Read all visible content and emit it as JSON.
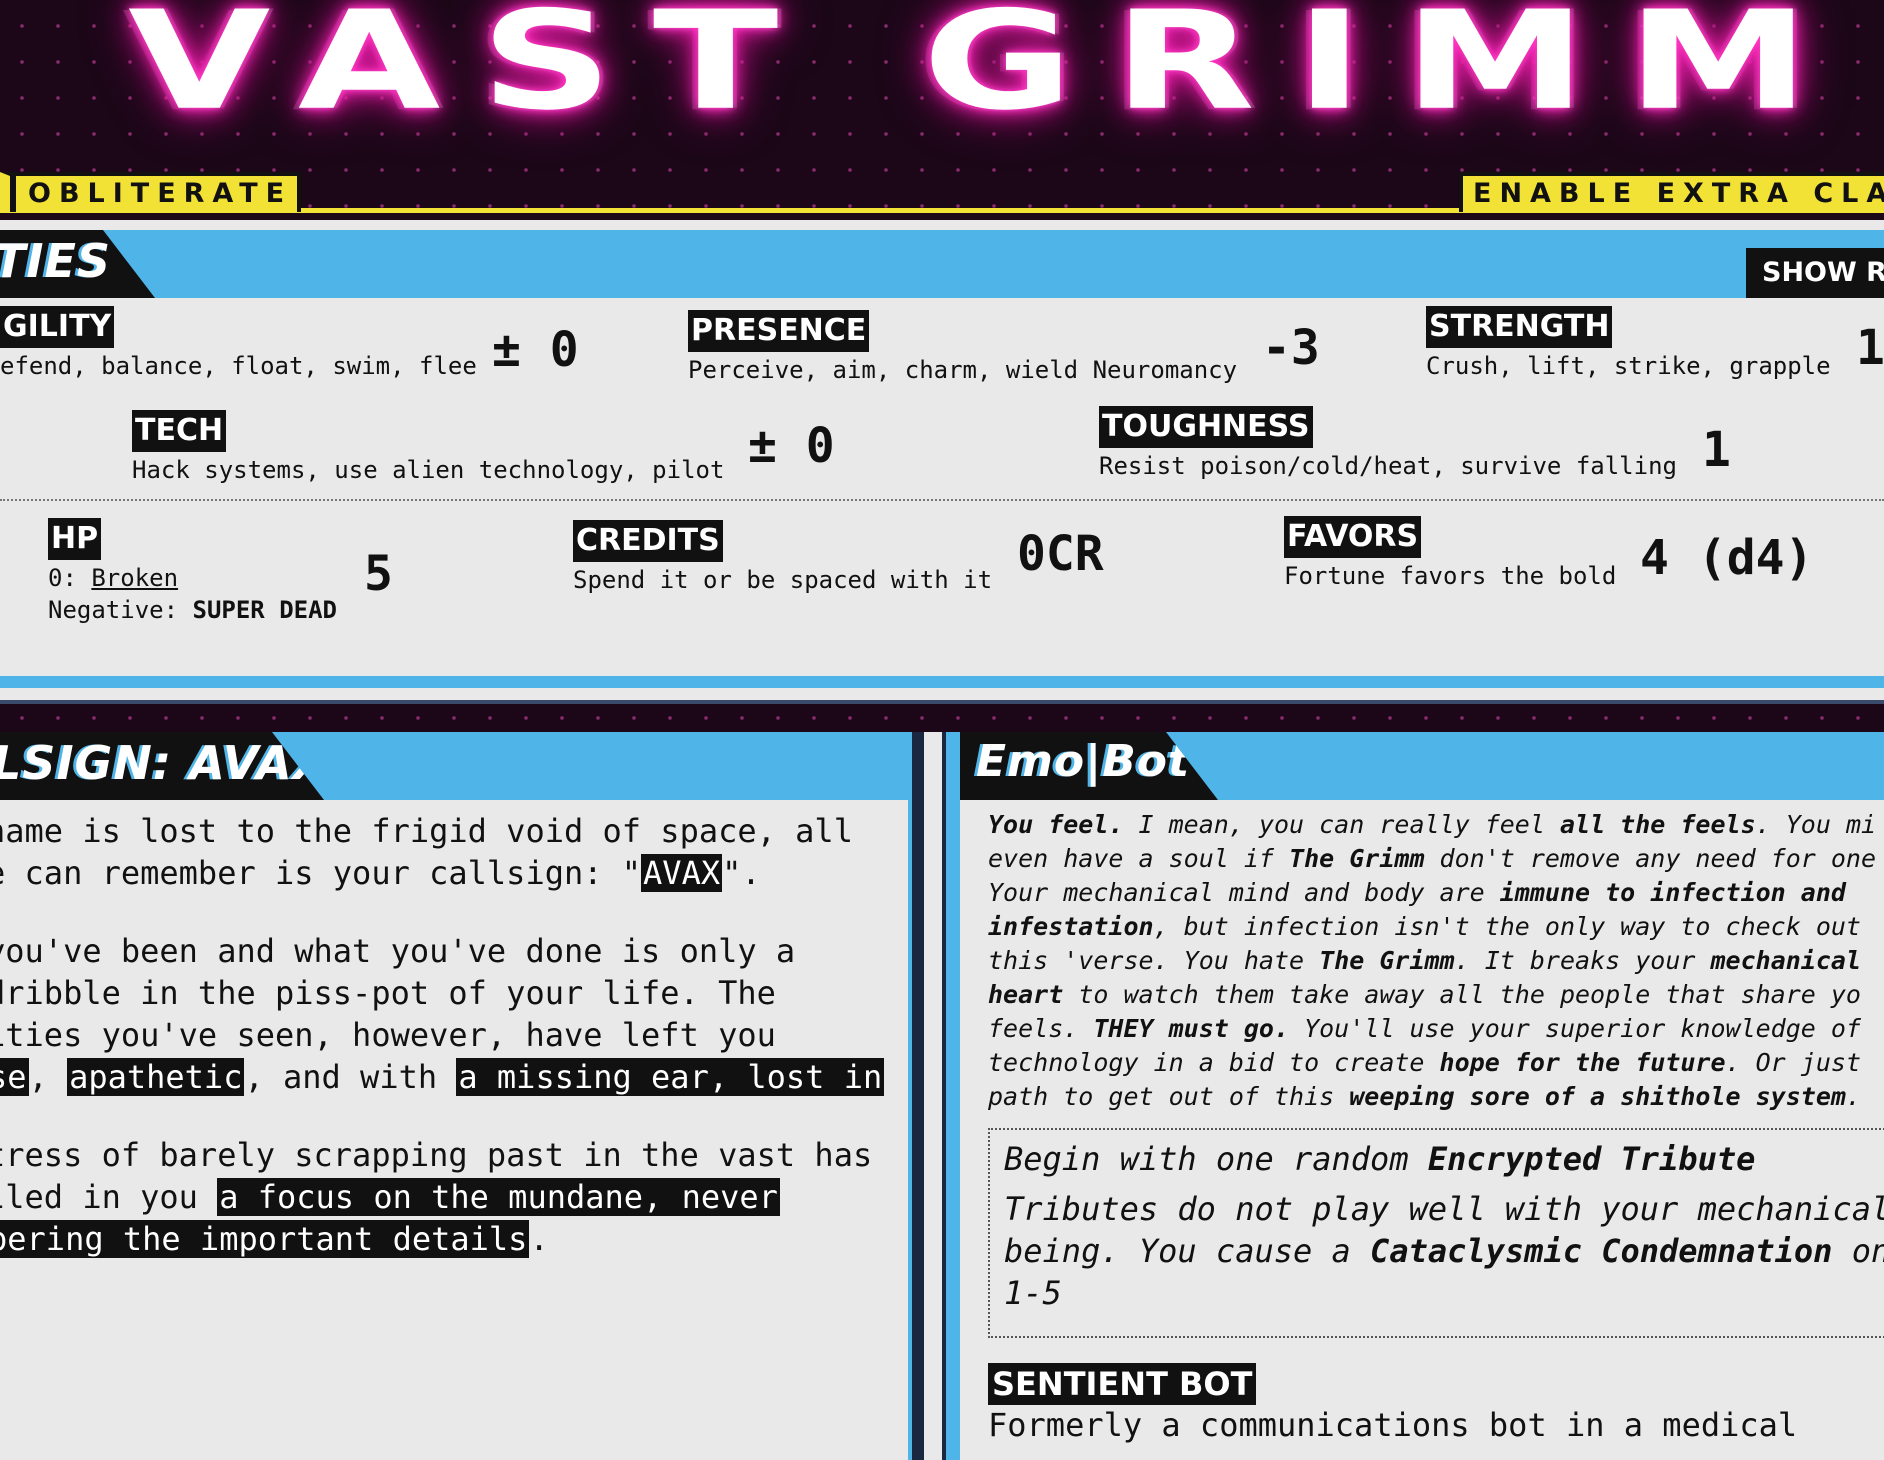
{
  "header": {
    "title": "VAST GRIMM",
    "obliterate_label": "OBLITERATE",
    "extra_class_label": "ENABLE EXTRA CLA"
  },
  "abilities": {
    "section_title": "TIES",
    "show_rolls_label": "SHOW RO",
    "stats": [
      {
        "name": "GILITY",
        "desc": "efend, balance, float, swim, flee",
        "value": "± 0"
      },
      {
        "name": "PRESENCE",
        "desc": "Perceive, aim, charm, wield Neuromancy",
        "value": "-3"
      },
      {
        "name": "STRENGTH",
        "desc": "Crush, lift, strike, grapple",
        "value": "1"
      },
      {
        "name": "TECH",
        "desc": "Hack systems, use alien technology, pilot",
        "value": "± 0"
      },
      {
        "name": "TOUGHNESS",
        "desc": "Resist poison/cold/heat, survive falling",
        "value": "1"
      }
    ],
    "hp": {
      "name": "HP",
      "zero_prefix": "0: ",
      "zero_state": "Broken",
      "negative_prefix": "Negative: ",
      "negative_state": "SUPER DEAD",
      "value": "5"
    },
    "credits": {
      "name": "CREDITS",
      "desc": "Spend it or be spaced with it",
      "value": "0CR"
    },
    "favors": {
      "name": "FAVORS",
      "desc": "Fortune favors the bold",
      "value": "4 (d4)"
    }
  },
  "callsign": {
    "title": "LSIGN: AVAX",
    "p1": {
      "l1": "name is lost to the frigid void of space, all",
      "l2_a": "e can remember is your callsign: \"",
      "l2_hl": "AVAX",
      "l2_b": "\"."
    },
    "p2": {
      "l1": " you've been and what you've done is only a",
      "l2": " dribble in the piss-pot of your life. The",
      "l3": "ities you've seen, however, have left you",
      "l4_hl1": "se",
      "l4_sep": ", ",
      "l4_hl2": "apathetic",
      "l4_mid": ", and with ",
      "l4_hl3": "a missing ear, lost in",
      "l5": "."
    },
    "p3": {
      "l1": "tress of barely scrapping past in the vast has",
      "l2_a": "lled in you ",
      "l2_hl": "a focus on the mundane, never",
      "l3_hl": "pering the important details",
      "l3_b": "."
    }
  },
  "emobot": {
    "title": "Emo|Bot",
    "desc": [
      {
        "t": "You feel.",
        "b": true
      },
      {
        "t": " I mean, you can really feel "
      },
      {
        "t": "all the feels",
        "b": true
      },
      {
        "t": ". You mi"
      },
      {
        "br": true
      },
      {
        "t": "even have a soul if "
      },
      {
        "t": "The Grimm",
        "b": true
      },
      {
        "t": " don't remove any need for one"
      },
      {
        "br": true
      },
      {
        "t": "Your mechanical mind and body are "
      },
      {
        "t": "immune to infection and",
        "b": true
      },
      {
        "br": true
      },
      {
        "t": "infestation",
        "b": true
      },
      {
        "t": ", but infection isn't the only way to check out"
      },
      {
        "br": true
      },
      {
        "t": "this 'verse. You hate "
      },
      {
        "t": "The Grimm",
        "b": true
      },
      {
        "t": ". It breaks your "
      },
      {
        "t": "mechanical",
        "b": true
      },
      {
        "br": true
      },
      {
        "t": "heart",
        "b": true
      },
      {
        "t": " to watch them take away all the people that share yo"
      },
      {
        "br": true
      },
      {
        "t": "feels. "
      },
      {
        "t": "THEY must go.",
        "b": true
      },
      {
        "t": " You'll use your superior knowledge of"
      },
      {
        "br": true
      },
      {
        "t": "technology in a bid to create "
      },
      {
        "t": "hope for the future",
        "b": true
      },
      {
        "t": ". Or just"
      },
      {
        "br": true
      },
      {
        "t": "path to get out of this "
      },
      {
        "t": "weeping sore of a shithole system",
        "b": true
      },
      {
        "t": "."
      }
    ],
    "tribute": {
      "l1_a": "Begin with one random ",
      "l1_b": "Encrypted Tribute",
      "l2": "Tributes do not play well with your mechanical",
      "l3_a": "being. You cause a ",
      "l3_b": "Cataclysmic Condemnation",
      "l3_c": " on",
      "l4": "1-5"
    },
    "sentient_heading": "SENTIENT BOT",
    "sentient_text": "Formerly a communications bot in a medical"
  },
  "colors": {
    "header_bg": "#1b0718",
    "accent_yellow": "#f2e236",
    "accent_blue": "#4fb4e8",
    "neon_pink": "#ff2fbf",
    "panel_bg": "#e9e9e9"
  }
}
